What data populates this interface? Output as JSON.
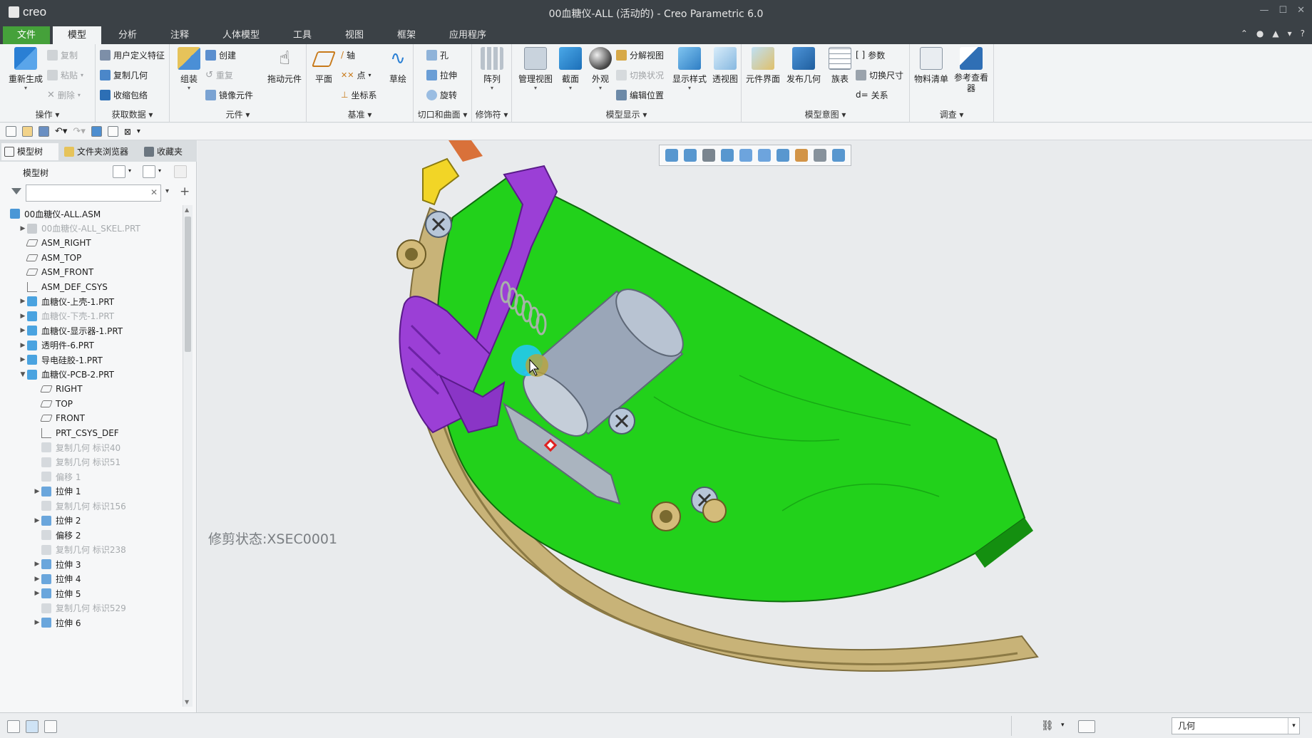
{
  "window": {
    "app_logo": "creo",
    "title": "00血糖仪-ALL (活动的) - Creo Parametric 6.0"
  },
  "ribbon_tabs": [
    "文件",
    "模型",
    "分析",
    "注释",
    "人体模型",
    "工具",
    "视图",
    "框架",
    "应用程序"
  ],
  "active_tab": "模型",
  "ribbon": {
    "operations": {
      "regenerate": "重新生成",
      "copy": "复制",
      "paste": "粘贴",
      "delete": "删除",
      "group_label": "操作"
    },
    "get_data": {
      "udf": "用户定义特征",
      "copy_geom": "复制几何",
      "shrinkwrap": "收缩包络",
      "group_label": "获取数据"
    },
    "component": {
      "assemble": "组装",
      "create": "创建",
      "repeat": "重复",
      "mirror": "镜像元件",
      "drag": "拖动元件",
      "group_label": "元件"
    },
    "datum": {
      "plane": "平面",
      "axis": "轴",
      "point": "点",
      "csys": "坐标系",
      "sketch": "草绘",
      "group_label": "基准"
    },
    "cut_surface": {
      "hole": "孔",
      "extrude": "拉伸",
      "revolve": "旋转",
      "group_label": "切口和曲面"
    },
    "modifiers": {
      "pattern": "阵列",
      "group_label": "修饰符"
    },
    "model_display": {
      "manage_views": "管理视图",
      "section": "截面",
      "appearance": "外观",
      "explode": "分解视图",
      "toggle_status": "切换状况",
      "edit_position": "编辑位置",
      "display_style": "显示样式",
      "perspective": "透视图",
      "group_label": "模型显示"
    },
    "model_intent": {
      "component_interface": "元件界面",
      "publish_geom": "发布几何",
      "family_table": "族表",
      "params": "参数",
      "switch_dims": "切换尺寸",
      "relations": "关系",
      "group_label": "模型意图"
    },
    "investigate": {
      "bom": "物料清单",
      "ref_viewer": "参考查看器",
      "group_label": "调查"
    }
  },
  "left_panel": {
    "tabs": [
      "模型树",
      "文件夹浏览器",
      "收藏夹"
    ],
    "tree_label": "模型树",
    "filter_placeholder": "",
    "tree_items": [
      {
        "label": "00血糖仪-ALL.ASM",
        "level": 0,
        "expander": "",
        "icon": "assembly-icon",
        "dim": false
      },
      {
        "label": "00血糖仪-ALL_SKEL.PRT",
        "level": 1,
        "expander": "▶",
        "icon": "skeleton-part-icon",
        "dim": true
      },
      {
        "label": "ASM_RIGHT",
        "level": 1,
        "expander": "",
        "icon": "datum-plane-icon",
        "dim": false
      },
      {
        "label": "ASM_TOP",
        "level": 1,
        "expander": "",
        "icon": "datum-plane-icon",
        "dim": false
      },
      {
        "label": "ASM_FRONT",
        "level": 1,
        "expander": "",
        "icon": "datum-plane-icon",
        "dim": false
      },
      {
        "label": "ASM_DEF_CSYS",
        "level": 1,
        "expander": "",
        "icon": "csys-icon",
        "dim": false
      },
      {
        "label": "血糖仪-上壳-1.PRT",
        "level": 1,
        "expander": "▶",
        "icon": "part-icon",
        "dim": false
      },
      {
        "label": "血糖仪-下壳-1.PRT",
        "level": 1,
        "expander": "▶",
        "icon": "part-icon",
        "dim": true
      },
      {
        "label": "血糖仪-显示器-1.PRT",
        "level": 1,
        "expander": "▶",
        "icon": "part-icon",
        "dim": false
      },
      {
        "label": "透明件-6.PRT",
        "level": 1,
        "expander": "▶",
        "icon": "part-icon",
        "dim": false
      },
      {
        "label": "导电硅胶-1.PRT",
        "level": 1,
        "expander": "▶",
        "icon": "part-icon",
        "dim": false
      },
      {
        "label": "血糖仪-PCB-2.PRT",
        "level": 1,
        "expander": "▼",
        "icon": "part-icon",
        "dim": false
      },
      {
        "label": "RIGHT",
        "level": 2,
        "expander": "",
        "icon": "datum-plane-icon",
        "dim": false
      },
      {
        "label": "TOP",
        "level": 2,
        "expander": "",
        "icon": "datum-plane-icon",
        "dim": false
      },
      {
        "label": "FRONT",
        "level": 2,
        "expander": "",
        "icon": "datum-plane-icon",
        "dim": false
      },
      {
        "label": "PRT_CSYS_DEF",
        "level": 2,
        "expander": "",
        "icon": "csys-icon",
        "dim": false
      },
      {
        "label": "复制几何 标识40",
        "level": 2,
        "expander": "",
        "icon": "copy-geom-icon",
        "dim": true
      },
      {
        "label": "复制几何 标识51",
        "level": 2,
        "expander": "",
        "icon": "copy-geom-icon",
        "dim": true
      },
      {
        "label": "偏移 1",
        "level": 2,
        "expander": "",
        "icon": "offset-icon",
        "dim": true
      },
      {
        "label": "拉伸 1",
        "level": 2,
        "expander": "▶",
        "icon": "extrude-icon",
        "dim": false
      },
      {
        "label": "复制几何 标识156",
        "level": 2,
        "expander": "",
        "icon": "copy-geom-icon",
        "dim": true
      },
      {
        "label": "拉伸 2",
        "level": 2,
        "expander": "▶",
        "icon": "extrude-icon",
        "dim": false
      },
      {
        "label": "偏移 2",
        "level": 2,
        "expander": "",
        "icon": "offset-icon",
        "dim": false
      },
      {
        "label": "复制几何 标识238",
        "level": 2,
        "expander": "",
        "icon": "copy-geom-icon",
        "dim": true
      },
      {
        "label": "拉伸 3",
        "level": 2,
        "expander": "▶",
        "icon": "extrude-icon",
        "dim": false
      },
      {
        "label": "拉伸 4",
        "level": 2,
        "expander": "▶",
        "icon": "extrude-icon",
        "dim": false
      },
      {
        "label": "拉伸 5",
        "level": 2,
        "expander": "▶",
        "icon": "extrude-icon",
        "dim": false
      },
      {
        "label": "复制几何 标识529",
        "level": 2,
        "expander": "",
        "icon": "copy-geom-icon",
        "dim": true
      },
      {
        "label": "拉伸 6",
        "level": 2,
        "expander": "▶",
        "icon": "extrude-icon",
        "dim": false
      }
    ]
  },
  "graphics": {
    "section_status": "修剪状态:XSEC0001",
    "view_toolbar_icons": [
      "zoom-in-icon",
      "zoom-out-icon",
      "refit-icon",
      "repaint-icon",
      "saved-views-icon",
      "display-style-icon",
      "view-manager-icon",
      "datum-display-icon",
      "spin-center-icon",
      "annotation-display-icon"
    ]
  },
  "status_bar": {
    "selection_filter": "几何"
  },
  "colors": {
    "title_bar": "#3b4146",
    "file_tab": "#45a13a",
    "pcb_green": "#22d11b",
    "bracket_purple": "#9b3fd6",
    "housing_tan": "#c8b378",
    "clip_yellow": "#f2d526",
    "cylinder_gray": "#9aa6b8"
  }
}
